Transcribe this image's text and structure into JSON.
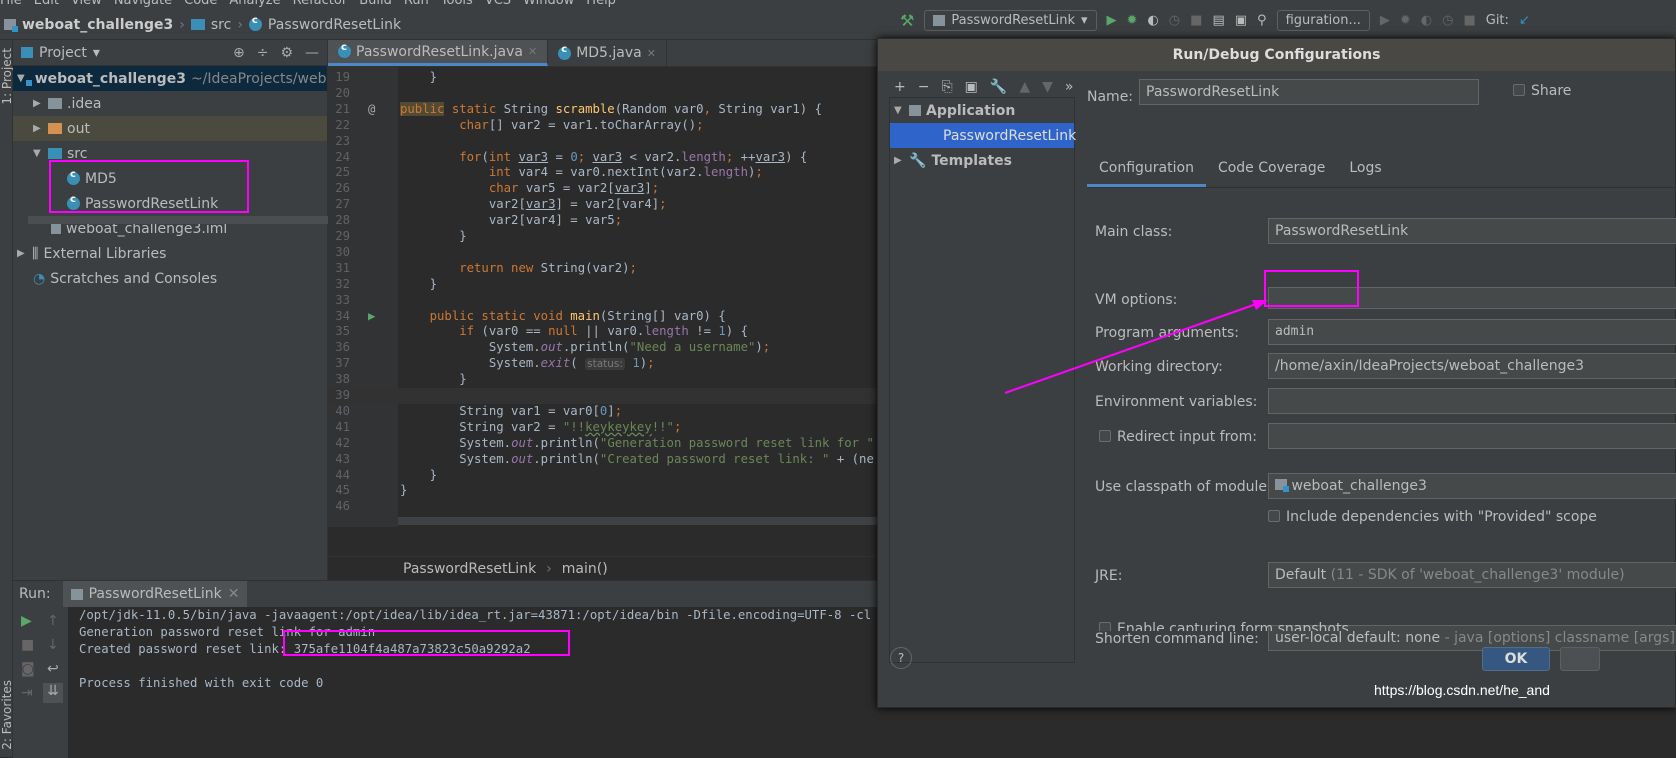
{
  "menu": [
    "File",
    "Edit",
    "View",
    "Navigate",
    "Code",
    "Analyze",
    "Refactor",
    "Build",
    "Run",
    "Tools",
    "VCS",
    "Window",
    "Help"
  ],
  "breadcrumb": {
    "project": "weboat_challenge3",
    "folder": "src",
    "file": "PasswordResetLink"
  },
  "toolbar": {
    "run_config": "PasswordResetLink",
    "second_config": "figuration...",
    "git": "Git:"
  },
  "side": {
    "project_strip": "1: Project",
    "favorites_strip": "2: Favorites"
  },
  "project": {
    "title": "Project",
    "root": "weboat_challenge3",
    "root_path": "~/IdeaProjects/weboat_challenge3",
    "items": [
      ".idea",
      "out",
      "src",
      "MD5",
      "PasswordResetLink",
      "weboat_challenge3.iml",
      "External Libraries",
      "Scratches and Consoles"
    ]
  },
  "editor": {
    "tabs": [
      "PasswordResetLink.java",
      "MD5.java"
    ],
    "breadcrumb": [
      "PasswordResetLink",
      "main()"
    ],
    "current_line": 39,
    "lines": [
      [
        19,
        [
          [
            "t",
            "    }"
          ]
        ]
      ],
      [
        20,
        []
      ],
      [
        21,
        [
          [
            "kh",
            "public"
          ],
          [
            "k",
            " static "
          ],
          [
            "t",
            "String "
          ],
          [
            "f",
            "scramble"
          ],
          [
            "t",
            "(Random var0"
          ],
          [
            "k",
            ", "
          ],
          [
            "t",
            "String var1) {"
          ]
        ]
      ],
      [
        22,
        [
          [
            "k",
            "        char"
          ],
          [
            "t",
            "[] var2 = var1.toCharArray()"
          ],
          [
            "k",
            ";"
          ]
        ]
      ],
      [
        23,
        []
      ],
      [
        24,
        [
          [
            "k",
            "        for"
          ],
          [
            "t",
            "("
          ],
          [
            "k",
            "int "
          ],
          [
            "u",
            "var3"
          ],
          [
            "t",
            " = "
          ],
          [
            "n",
            "0"
          ],
          [
            "k",
            "; "
          ],
          [
            "u",
            "var3"
          ],
          [
            "t",
            " < var2."
          ],
          [
            "p",
            "length"
          ],
          [
            "k",
            "; "
          ],
          [
            "t",
            "++"
          ],
          [
            "u",
            "var3"
          ],
          [
            "t",
            ") {"
          ]
        ]
      ],
      [
        25,
        [
          [
            "k",
            "            int "
          ],
          [
            "t",
            "var4 = var0.nextInt(var2."
          ],
          [
            "p",
            "length"
          ],
          [
            "t",
            ")"
          ],
          [
            "k",
            ";"
          ]
        ]
      ],
      [
        26,
        [
          [
            "k",
            "            char "
          ],
          [
            "t",
            "var5 = var2["
          ],
          [
            "u",
            "var3"
          ],
          [
            "t",
            "]"
          ],
          [
            "k",
            ";"
          ]
        ]
      ],
      [
        27,
        [
          [
            "t",
            "            var2["
          ],
          [
            "u",
            "var3"
          ],
          [
            "t",
            "] = var2[var4]"
          ],
          [
            "k",
            ";"
          ]
        ]
      ],
      [
        28,
        [
          [
            "t",
            "            var2[var4] = var5"
          ],
          [
            "k",
            ";"
          ]
        ]
      ],
      [
        29,
        [
          [
            "t",
            "        }"
          ]
        ]
      ],
      [
        30,
        []
      ],
      [
        31,
        [
          [
            "k",
            "        return new "
          ],
          [
            "t",
            "String(var2)"
          ],
          [
            "k",
            ";"
          ]
        ]
      ],
      [
        32,
        [
          [
            "t",
            "    }"
          ]
        ]
      ],
      [
        33,
        []
      ],
      [
        34,
        [
          [
            "k",
            "    public static void "
          ],
          [
            "f",
            "main"
          ],
          [
            "t",
            "(String[] var0) {"
          ]
        ]
      ],
      [
        35,
        [
          [
            "k",
            "        if "
          ],
          [
            "t",
            "(var0 == "
          ],
          [
            "k",
            "null "
          ],
          [
            "t",
            "|| var0."
          ],
          [
            "p",
            "length"
          ],
          [
            "t",
            " != "
          ],
          [
            "n",
            "1"
          ],
          [
            "t",
            ") {"
          ]
        ]
      ],
      [
        36,
        [
          [
            "t",
            "            System."
          ],
          [
            "i",
            "out"
          ],
          [
            "t",
            ".println("
          ],
          [
            "s",
            "\"Need a username\""
          ],
          [
            "t",
            ")"
          ],
          [
            "k",
            ";"
          ]
        ]
      ],
      [
        37,
        [
          [
            "t",
            "            System."
          ],
          [
            "i",
            "exit"
          ],
          [
            "t",
            "( "
          ],
          [
            "h",
            "status:"
          ],
          [
            "n",
            " 1"
          ],
          [
            "t",
            ")"
          ],
          [
            "k",
            ";"
          ]
        ]
      ],
      [
        38,
        [
          [
            "t",
            "        }"
          ]
        ]
      ],
      [
        39,
        []
      ],
      [
        40,
        [
          [
            "t",
            "        String var1 = var0["
          ],
          [
            "n",
            "0"
          ],
          [
            "t",
            "]"
          ],
          [
            "k",
            ";"
          ]
        ]
      ],
      [
        41,
        [
          [
            "t",
            "        String var2 = "
          ],
          [
            "s",
            "\"!!"
          ],
          [
            "sw",
            "keykeykey"
          ],
          [
            "s",
            "!!\""
          ],
          [
            "k",
            ";"
          ]
        ]
      ],
      [
        42,
        [
          [
            "t",
            "        System."
          ],
          [
            "i",
            "out"
          ],
          [
            "t",
            ".println("
          ],
          [
            "s",
            "\"Generation password reset link for \""
          ]
        ]
      ],
      [
        43,
        [
          [
            "t",
            "        System."
          ],
          [
            "i",
            "out"
          ],
          [
            "t",
            ".println("
          ],
          [
            "s",
            "\"Created password reset link: \""
          ],
          [
            "t",
            " + (ne"
          ]
        ]
      ],
      [
        44,
        [
          [
            "t",
            "    }"
          ]
        ]
      ],
      [
        45,
        [
          [
            "t",
            "}"
          ]
        ]
      ],
      [
        46,
        []
      ]
    ]
  },
  "run": {
    "label": "Run:",
    "tab": "PasswordResetLink",
    "output": [
      "/opt/jdk-11.0.5/bin/java -javaagent:/opt/idea/lib/idea_rt.jar=43871:/opt/idea/bin -Dfile.encoding=UTF-8 -cl",
      "Generation password reset link for admin",
      "Created password reset link: 375afe1104f4a487a73823c50a9292a2",
      "",
      "Process finished with exit code 0"
    ]
  },
  "dialog": {
    "title": "Run/Debug Configurations",
    "tree": {
      "application": "Application",
      "config": "PasswordResetLink",
      "templates": "Templates"
    },
    "name_label": "Name:",
    "name_value": "PasswordResetLink",
    "share_label": "Share",
    "tabs": [
      "Configuration",
      "Code Coverage",
      "Logs"
    ],
    "main_class_label": "Main class:",
    "main_class": "PasswordResetLink",
    "vm_options_label": "VM options:",
    "vm_options": "",
    "program_args_label": "Program arguments:",
    "program_args": "admin",
    "working_dir_label": "Working directory:",
    "working_dir": "/home/axin/IdeaProjects/weboat_challenge3",
    "env_label": "Environment variables:",
    "env": "",
    "redirect_label": "Redirect input from:",
    "classpath_label": "Use classpath of module:",
    "classpath": "weboat_challenge3",
    "include_deps_label": "Include dependencies with \"Provided\" scope",
    "jre_label": "JRE:",
    "jre_default": "Default",
    "jre_detail": "(11 - SDK of 'weboat_challenge3' module)",
    "shorten_label": "Shorten command line:",
    "shorten_value": "user-local default: none",
    "shorten_detail": "- java [options] classname [args]",
    "snapshots_label": "Enable capturing form snapshots",
    "ok": "OK",
    "help": "?"
  },
  "watermark": "https://blog.csdn.net/he_and",
  "colors": {
    "annotation": "#ff00ff",
    "accent": "#4a88c7",
    "selection": "#2f65ca"
  }
}
